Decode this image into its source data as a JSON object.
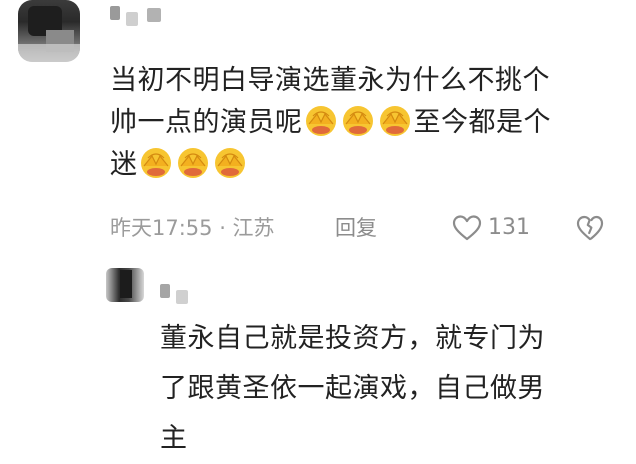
{
  "comment": {
    "text_line1": "当初不明白导演选董永为什么不挑个",
    "text_line2_pre": "帅一点的演员呢",
    "text_line2_post": "至今都是个",
    "text_line3_pre": "迷",
    "emoji_name": "facepalm-emoji",
    "time_location": "昨天17:55 · 江苏",
    "reply_label": "回复",
    "like_count": "131"
  },
  "reply": {
    "text_line1": "董永自己就是投资方，就专门为",
    "text_line2": "了跟黄圣依一起演戏，自己做男",
    "text_line3": "主"
  },
  "icons": {
    "like": "heart-outline-icon",
    "dislike": "broken-heart-icon"
  },
  "colors": {
    "text": "#222222",
    "meta": "#9b9b9b",
    "emoji_face": "#f7c531"
  }
}
